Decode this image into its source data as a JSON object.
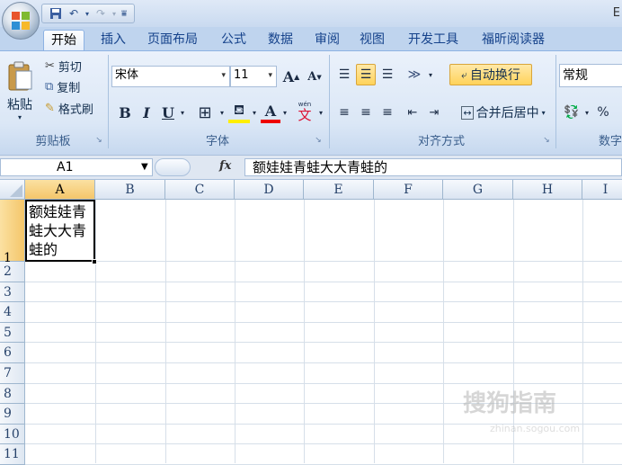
{
  "window": {
    "title_partial": "E"
  },
  "quick_access": {
    "save_icon": "save-icon",
    "undo_icon": "undo-icon",
    "redo_icon": "redo-icon",
    "customize_icon": "customize-icon"
  },
  "tabs": [
    "开始",
    "插入",
    "页面布局",
    "公式",
    "数据",
    "审阅",
    "视图",
    "开发工具",
    "福昕阅读器"
  ],
  "active_tab": "开始",
  "clipboard": {
    "paste_label": "粘贴",
    "cut_label": "剪切",
    "copy_label": "复制",
    "format_painter_label": "格式刷",
    "group_label": "剪贴板"
  },
  "font": {
    "family": "宋体",
    "size": "11",
    "grow_label": "A",
    "shrink_label": "A",
    "bold_label": "B",
    "italic_label": "I",
    "underline_label": "U",
    "font_color_label": "A",
    "phonetic_label": "wén",
    "phonetic_glyph": "文",
    "group_label": "字体"
  },
  "alignment": {
    "wrap_text_label": "自动换行",
    "merge_center_label": "合并后居中",
    "group_label": "对齐方式"
  },
  "number": {
    "format": "常规",
    "percent_label": "%",
    "group_label": "数字"
  },
  "formula_bar": {
    "name_box": "A1",
    "fx_label": "fx",
    "content": "额娃娃青蛙大大青蛙的"
  },
  "columns": [
    "A",
    "B",
    "C",
    "D",
    "E",
    "F",
    "G",
    "H",
    "I"
  ],
  "rows": [
    "1",
    "2",
    "3",
    "4",
    "5",
    "6",
    "7",
    "8",
    "9",
    "10",
    "11"
  ],
  "cell_a1": "额娃娃青蛙大大青蛙的",
  "watermark": {
    "text": "搜狗指南",
    "sub": "zhinan.sogou.com"
  }
}
